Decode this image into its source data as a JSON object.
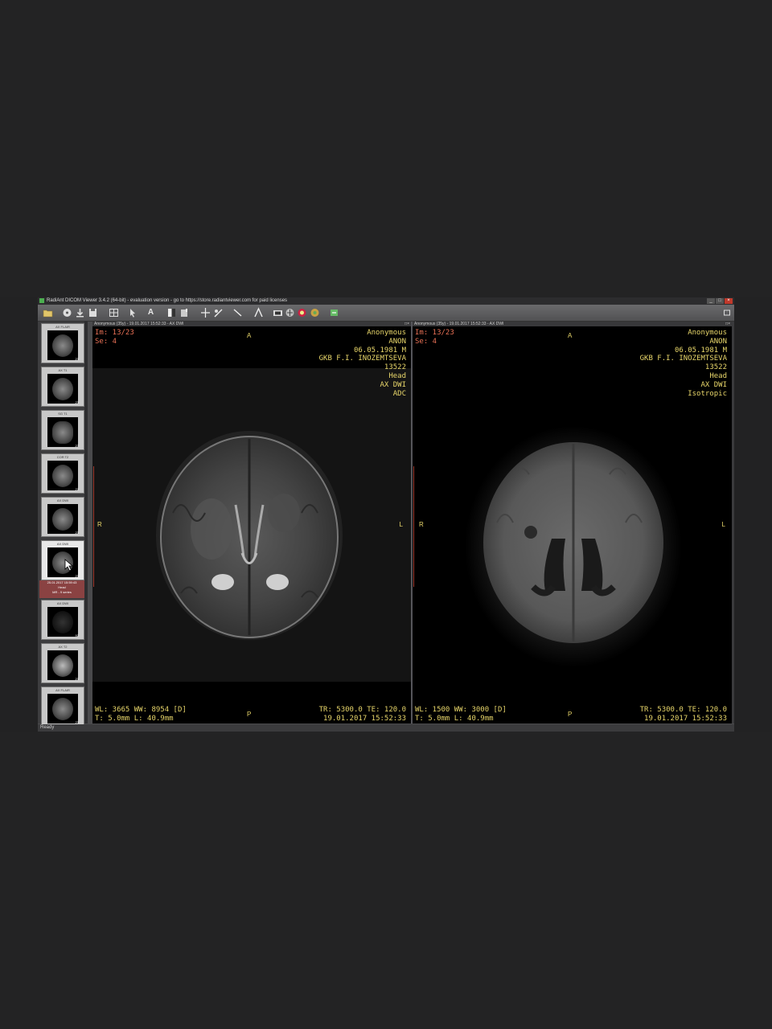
{
  "window": {
    "title": "RadiAnt DICOM Viewer 3.4.2 (64-bit) - evaluation version - go to https://store.radiantviewer.com for paid licenses",
    "buttons": [
      "_",
      "□",
      "×"
    ]
  },
  "toolbar": {
    "icons": [
      "open-folder-icon",
      "cd-icon",
      "download-icon",
      "save-icon",
      "layout-icon",
      "pointer-icon",
      "text-icon",
      "window-level-icon",
      "zoom-icon",
      "crosshair-icon",
      "measure-icon",
      "angle-icon",
      "screenshot-icon",
      "3d-icon",
      "mpr-icon",
      "fusion-icon",
      "help-icon"
    ],
    "text_tool_label": "A"
  },
  "thumbnails": [
    {
      "label": "AX FLAIR",
      "count": "23"
    },
    {
      "label": "AX T1",
      "count": "23"
    },
    {
      "label": "SG T1",
      "count": "27"
    },
    {
      "label": "COR T2",
      "count": "22"
    },
    {
      "label": "AX DWI",
      "count": "23"
    },
    {
      "label": "AX DWI",
      "count": "23"
    },
    {
      "label": "AX DWI",
      "count": "92"
    },
    {
      "label": "AX T2",
      "count": "23"
    },
    {
      "label": "AX FLAIR",
      "count": "23"
    }
  ],
  "thumbnail_info": {
    "line1": "25.01.2017 15:59:43",
    "line2": "Head",
    "line3": "MR - 9 series"
  },
  "viewports": [
    {
      "title": "Anonymous (35y) - 19.01.2017 15:52:33 - AX DWI",
      "im": "Im: 13/23",
      "se": "Se: 4",
      "info": [
        "Anonymous",
        "ANON",
        "06.05.1981 M",
        "GKB F.I. INOZEMTSEVA",
        "13522",
        "Head",
        "AX DWI",
        "ADC"
      ],
      "orient": {
        "top": "A",
        "bottom": "P",
        "left": "R",
        "right": "L"
      },
      "wl": "WL: 3665 WW: 8954 [D]",
      "thickness": "T: 5.0mm L: 40.9mm",
      "trte": "TR: 5300.0 TE: 120.0",
      "datetime": "19.01.2017 15:52:33"
    },
    {
      "title": "Anonymous (35y) - 19.01.2017 15:52:33 - AX DWI",
      "im": "Im: 13/23",
      "se": "Se: 4",
      "info": [
        "Anonymous",
        "ANON",
        "06.05.1981 M",
        "GKB F.I. INOZEMTSEVA",
        "13522",
        "Head",
        "AX DWI",
        "Isotropic"
      ],
      "orient": {
        "top": "A",
        "bottom": "P",
        "left": "R",
        "right": "L"
      },
      "wl": "WL: 1500 WW: 3000 [D]",
      "thickness": "T: 5.0mm L: 40.9mm",
      "trte": "TR: 5300.0 TE: 120.0",
      "datetime": "19.01.2017 15:52:33"
    }
  ],
  "status": {
    "text": "Ready"
  }
}
